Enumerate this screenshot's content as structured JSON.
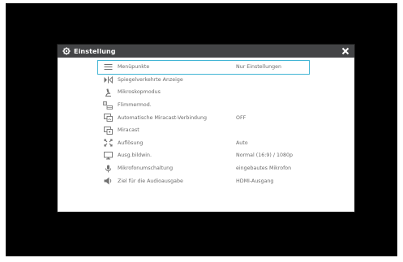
{
  "dialog": {
    "title": "Einstellung",
    "close_label": "✕"
  },
  "colors": {
    "titlebar": "#434446",
    "selection": "#40b4d4",
    "text": "#6b6b6b",
    "background": "#000000"
  },
  "menu": {
    "items": [
      {
        "label": "Menüpunkte",
        "value": "Nur Einstellungen",
        "icon": "menu-lines-icon",
        "selected": true
      },
      {
        "label": "Spiegelverkehrte Anzeige",
        "value": "",
        "icon": "mirror-icon"
      },
      {
        "label": "Mikroskopmodus",
        "value": "",
        "icon": "microscope-icon"
      },
      {
        "label": "Flimmermod.",
        "value": "",
        "icon": "flicker-icon"
      },
      {
        "label": "Automatische Miracast-Verbindung",
        "value": "OFF",
        "icon": "auto-miracast-icon"
      },
      {
        "label": "Miracast",
        "value": "",
        "icon": "miracast-icon"
      },
      {
        "label": "Auflösung",
        "value": "Auto",
        "icon": "resolution-icon"
      },
      {
        "label": "Ausg.bildwin.",
        "value": "Normal (16:9) / 1080p",
        "icon": "monitor-icon"
      },
      {
        "label": "Mikrofonumschaltung",
        "value": "eingebautes Mikrofon",
        "icon": "microphone-icon"
      },
      {
        "label": "Ziel für die Audioausgabe",
        "value": "HDMI-Ausgang",
        "icon": "speaker-icon"
      }
    ]
  }
}
